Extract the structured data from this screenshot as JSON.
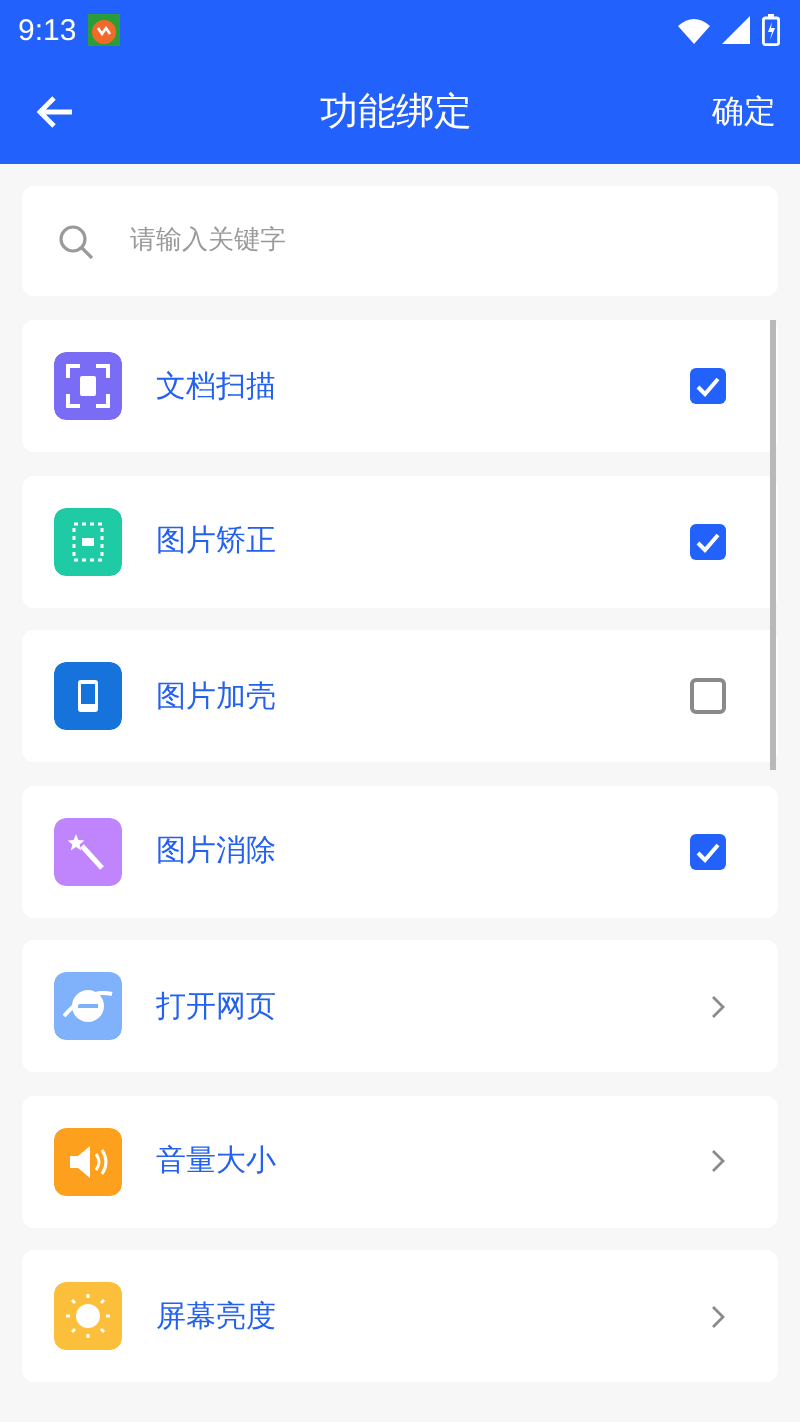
{
  "status_bar": {
    "time": "9:13"
  },
  "app_bar": {
    "title": "功能绑定",
    "action": "确定"
  },
  "search": {
    "placeholder": "请输入关键字"
  },
  "functions": [
    {
      "label": "文档扫描",
      "kind": "checkbox",
      "checked": true,
      "color": "#7b6cf6"
    },
    {
      "label": "图片矫正",
      "kind": "checkbox",
      "checked": true,
      "color": "#1fcba5"
    },
    {
      "label": "图片加壳",
      "kind": "checkbox",
      "checked": false,
      "color": "#1673db"
    },
    {
      "label": "图片消除",
      "kind": "checkbox",
      "checked": true,
      "color": "#c084fc"
    },
    {
      "label": "打开网页",
      "kind": "link",
      "color": "#7fb2fb"
    },
    {
      "label": "音量大小",
      "kind": "link",
      "color": "#fca01e"
    },
    {
      "label": "屏幕亮度",
      "kind": "link",
      "color": "#fbbf3c"
    }
  ]
}
